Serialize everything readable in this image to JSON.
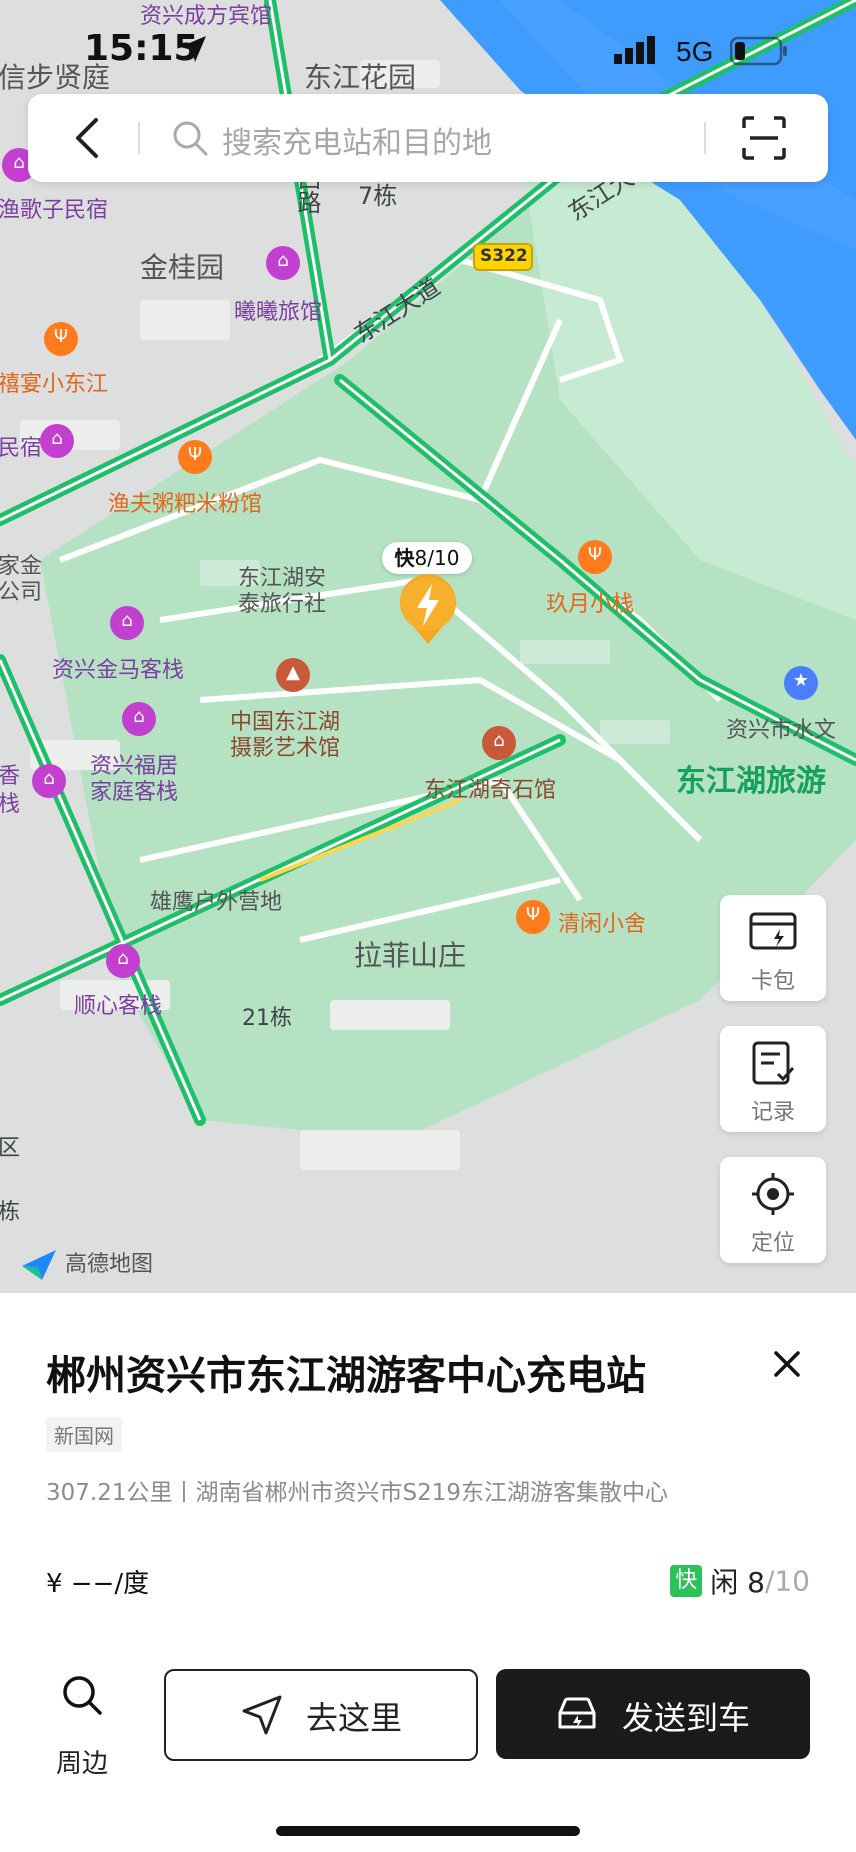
{
  "status_bar": {
    "time": "15:15",
    "network": "5G"
  },
  "search": {
    "placeholder": "搜索充电站和目的地"
  },
  "map": {
    "road_labels": [
      "东江大道",
      "东江大",
      "S322",
      "西路"
    ],
    "area_labels": [
      "东江花园",
      "金桂园",
      "拉菲山庄",
      "7栋",
      "21栋",
      "栋",
      "区"
    ],
    "poi_labels": {
      "top_hotel": "资兴成方宾馆",
      "xinbu": "信步贤庭",
      "minsu": "渔歌子民宿",
      "xixi": "曦曦旅馆",
      "xiyan": "禧宴小东江",
      "minsu2": "民宿",
      "yufu": "渔夫粥粑米粉馆",
      "jiajin": "家金",
      "gongsi": "公司",
      "donghu_travel_1": "东江湖安",
      "donghu_travel_2": "泰旅行社",
      "jinma": "资兴金马客栈",
      "fuju_1": "资兴福居",
      "fuju_2": "家庭客栈",
      "xiang": "香",
      "zhan": "栈",
      "photo_1": "中国东江湖",
      "photo_2": "摄影艺术馆",
      "stone": "东江湖奇石馆",
      "jiuyue": "玖月小栈",
      "water": "资兴市水文",
      "tourist": "东江湖旅游",
      "eagle": "雄鹰户外营地",
      "qingxian": "清闲小舍",
      "shunxin": "顺心客栈"
    },
    "charge_badge": {
      "type_label": "快",
      "free": "8",
      "total": "/10"
    },
    "logo": "高德地图"
  },
  "side_buttons": [
    {
      "label": "卡包",
      "icon": "card-icon"
    },
    {
      "label": "记录",
      "icon": "record-icon"
    },
    {
      "label": "定位",
      "icon": "locate-icon"
    }
  ],
  "station": {
    "name": "郴州资兴市东江湖游客中心充电站",
    "operator": "新国网",
    "address": "307.21公里丨湖南省郴州市资兴市S219东江湖游客集散中心",
    "price": "¥ −−/度",
    "fast_label": "快",
    "idle_label": "闲 8",
    "idle_total": "/10"
  },
  "actions": {
    "nearby": "周边",
    "go": "去这里",
    "send": "发送到车"
  }
}
